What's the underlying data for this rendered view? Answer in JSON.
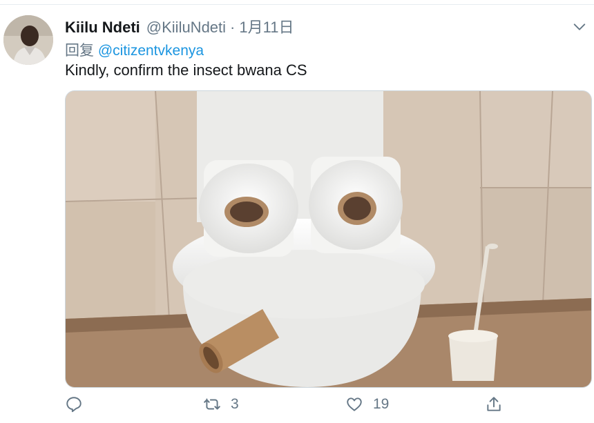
{
  "tweet": {
    "author_name": "Kiilu Ndeti",
    "handle": "@KiiluNdeti",
    "separator": "·",
    "date": "1月11日",
    "reply_prefix": "回复",
    "reply_to": "@citizentvkenya",
    "text": "Kindly, confirm the insect bwana CS"
  },
  "actions": {
    "reply_count": "",
    "retweet_count": "3",
    "like_count": "19"
  },
  "icons": {
    "caret": "chevron-down-icon",
    "reply": "reply-icon",
    "retweet": "retweet-icon",
    "like": "heart-icon",
    "share": "share-icon"
  },
  "colors": {
    "accent": "#1b95e0",
    "secondary_text": "#657786",
    "border": "#e6ecf0"
  }
}
